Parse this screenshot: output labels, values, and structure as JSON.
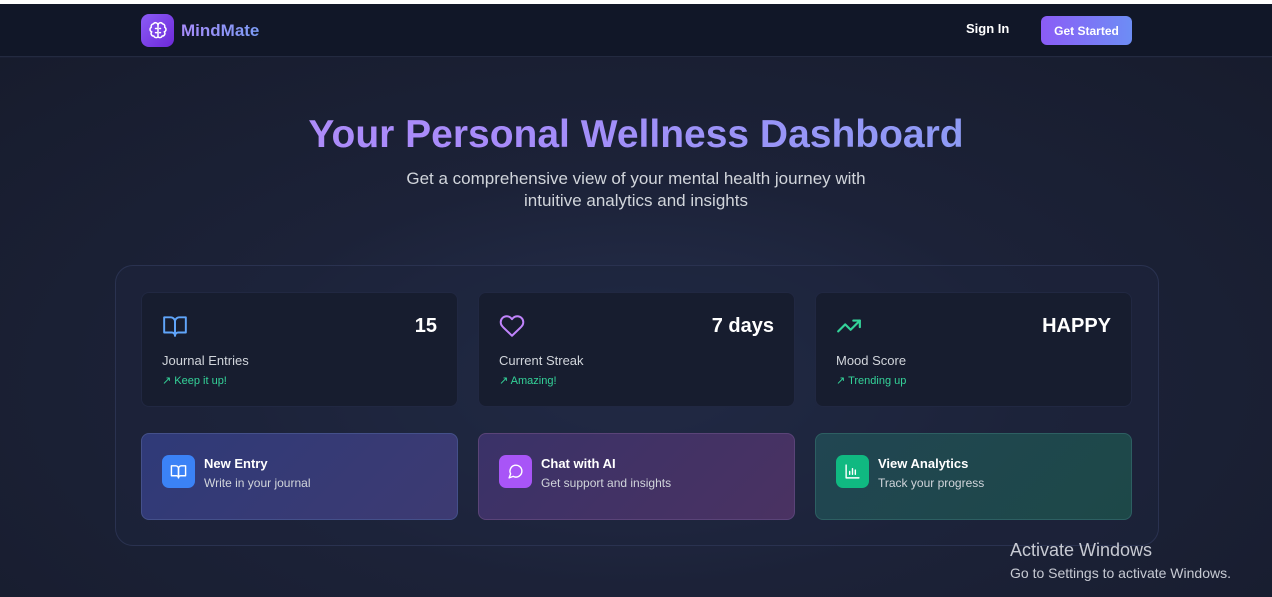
{
  "nav": {
    "brand": "MindMate",
    "sign_in": "Sign In",
    "get_started": "Get Started"
  },
  "hero": {
    "title": "Your Personal Wellness Dashboard",
    "subtitle": "Get a comprehensive view of your mental health journey with intuitive analytics and insights"
  },
  "stats": [
    {
      "icon": "book-open-icon",
      "value": "15",
      "label": "Journal Entries",
      "trend": "↗ Keep it up!"
    },
    {
      "icon": "heart-icon",
      "value": "7 days",
      "label": "Current Streak",
      "trend": "↗ Amazing!"
    },
    {
      "icon": "trending-up-icon",
      "value": "HAPPY",
      "label": "Mood Score",
      "trend": "↗ Trending up"
    }
  ],
  "actions": [
    {
      "icon": "book-icon",
      "title": "New Entry",
      "subtitle": "Write in your journal"
    },
    {
      "icon": "chat-bubble-icon",
      "title": "Chat with AI",
      "subtitle": "Get support and insights"
    },
    {
      "icon": "bar-chart-icon",
      "title": "View Analytics",
      "subtitle": "Track your progress"
    }
  ],
  "watermark": {
    "line1": "Activate Windows",
    "line2": "Go to Settings to activate Windows."
  },
  "colors": {
    "accent_purple": "#8b5cf6",
    "accent_blue": "#6d8df5",
    "trend_green": "#34d399",
    "background": "#1a1f33"
  }
}
